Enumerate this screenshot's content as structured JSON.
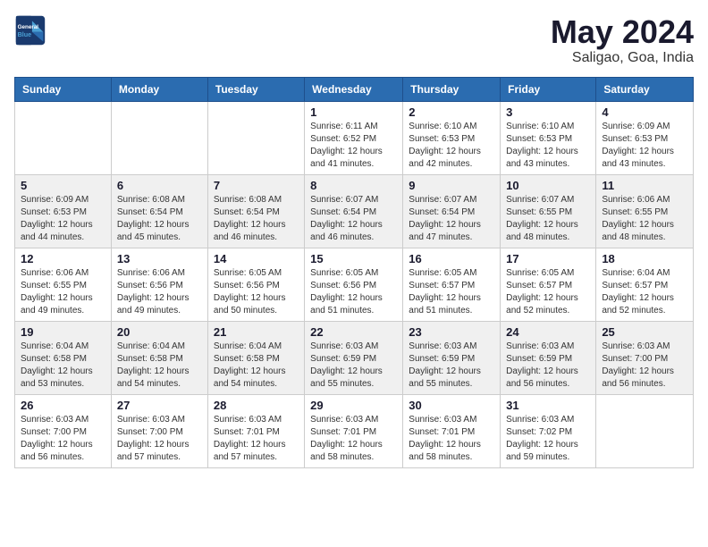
{
  "header": {
    "logo_line1": "General",
    "logo_line2": "Blue",
    "month_title": "May 2024",
    "location": "Saligao, Goa, India"
  },
  "weekdays": [
    "Sunday",
    "Monday",
    "Tuesday",
    "Wednesday",
    "Thursday",
    "Friday",
    "Saturday"
  ],
  "weeks": [
    [
      {
        "day": "",
        "info": ""
      },
      {
        "day": "",
        "info": ""
      },
      {
        "day": "",
        "info": ""
      },
      {
        "day": "1",
        "info": "Sunrise: 6:11 AM\nSunset: 6:52 PM\nDaylight: 12 hours\nand 41 minutes."
      },
      {
        "day": "2",
        "info": "Sunrise: 6:10 AM\nSunset: 6:53 PM\nDaylight: 12 hours\nand 42 minutes."
      },
      {
        "day": "3",
        "info": "Sunrise: 6:10 AM\nSunset: 6:53 PM\nDaylight: 12 hours\nand 43 minutes."
      },
      {
        "day": "4",
        "info": "Sunrise: 6:09 AM\nSunset: 6:53 PM\nDaylight: 12 hours\nand 43 minutes."
      }
    ],
    [
      {
        "day": "5",
        "info": "Sunrise: 6:09 AM\nSunset: 6:53 PM\nDaylight: 12 hours\nand 44 minutes."
      },
      {
        "day": "6",
        "info": "Sunrise: 6:08 AM\nSunset: 6:54 PM\nDaylight: 12 hours\nand 45 minutes."
      },
      {
        "day": "7",
        "info": "Sunrise: 6:08 AM\nSunset: 6:54 PM\nDaylight: 12 hours\nand 46 minutes."
      },
      {
        "day": "8",
        "info": "Sunrise: 6:07 AM\nSunset: 6:54 PM\nDaylight: 12 hours\nand 46 minutes."
      },
      {
        "day": "9",
        "info": "Sunrise: 6:07 AM\nSunset: 6:54 PM\nDaylight: 12 hours\nand 47 minutes."
      },
      {
        "day": "10",
        "info": "Sunrise: 6:07 AM\nSunset: 6:55 PM\nDaylight: 12 hours\nand 48 minutes."
      },
      {
        "day": "11",
        "info": "Sunrise: 6:06 AM\nSunset: 6:55 PM\nDaylight: 12 hours\nand 48 minutes."
      }
    ],
    [
      {
        "day": "12",
        "info": "Sunrise: 6:06 AM\nSunset: 6:55 PM\nDaylight: 12 hours\nand 49 minutes."
      },
      {
        "day": "13",
        "info": "Sunrise: 6:06 AM\nSunset: 6:56 PM\nDaylight: 12 hours\nand 49 minutes."
      },
      {
        "day": "14",
        "info": "Sunrise: 6:05 AM\nSunset: 6:56 PM\nDaylight: 12 hours\nand 50 minutes."
      },
      {
        "day": "15",
        "info": "Sunrise: 6:05 AM\nSunset: 6:56 PM\nDaylight: 12 hours\nand 51 minutes."
      },
      {
        "day": "16",
        "info": "Sunrise: 6:05 AM\nSunset: 6:57 PM\nDaylight: 12 hours\nand 51 minutes."
      },
      {
        "day": "17",
        "info": "Sunrise: 6:05 AM\nSunset: 6:57 PM\nDaylight: 12 hours\nand 52 minutes."
      },
      {
        "day": "18",
        "info": "Sunrise: 6:04 AM\nSunset: 6:57 PM\nDaylight: 12 hours\nand 52 minutes."
      }
    ],
    [
      {
        "day": "19",
        "info": "Sunrise: 6:04 AM\nSunset: 6:58 PM\nDaylight: 12 hours\nand 53 minutes."
      },
      {
        "day": "20",
        "info": "Sunrise: 6:04 AM\nSunset: 6:58 PM\nDaylight: 12 hours\nand 54 minutes."
      },
      {
        "day": "21",
        "info": "Sunrise: 6:04 AM\nSunset: 6:58 PM\nDaylight: 12 hours\nand 54 minutes."
      },
      {
        "day": "22",
        "info": "Sunrise: 6:03 AM\nSunset: 6:59 PM\nDaylight: 12 hours\nand 55 minutes."
      },
      {
        "day": "23",
        "info": "Sunrise: 6:03 AM\nSunset: 6:59 PM\nDaylight: 12 hours\nand 55 minutes."
      },
      {
        "day": "24",
        "info": "Sunrise: 6:03 AM\nSunset: 6:59 PM\nDaylight: 12 hours\nand 56 minutes."
      },
      {
        "day": "25",
        "info": "Sunrise: 6:03 AM\nSunset: 7:00 PM\nDaylight: 12 hours\nand 56 minutes."
      }
    ],
    [
      {
        "day": "26",
        "info": "Sunrise: 6:03 AM\nSunset: 7:00 PM\nDaylight: 12 hours\nand 56 minutes."
      },
      {
        "day": "27",
        "info": "Sunrise: 6:03 AM\nSunset: 7:00 PM\nDaylight: 12 hours\nand 57 minutes."
      },
      {
        "day": "28",
        "info": "Sunrise: 6:03 AM\nSunset: 7:01 PM\nDaylight: 12 hours\nand 57 minutes."
      },
      {
        "day": "29",
        "info": "Sunrise: 6:03 AM\nSunset: 7:01 PM\nDaylight: 12 hours\nand 58 minutes."
      },
      {
        "day": "30",
        "info": "Sunrise: 6:03 AM\nSunset: 7:01 PM\nDaylight: 12 hours\nand 58 minutes."
      },
      {
        "day": "31",
        "info": "Sunrise: 6:03 AM\nSunset: 7:02 PM\nDaylight: 12 hours\nand 59 minutes."
      },
      {
        "day": "",
        "info": ""
      }
    ]
  ]
}
